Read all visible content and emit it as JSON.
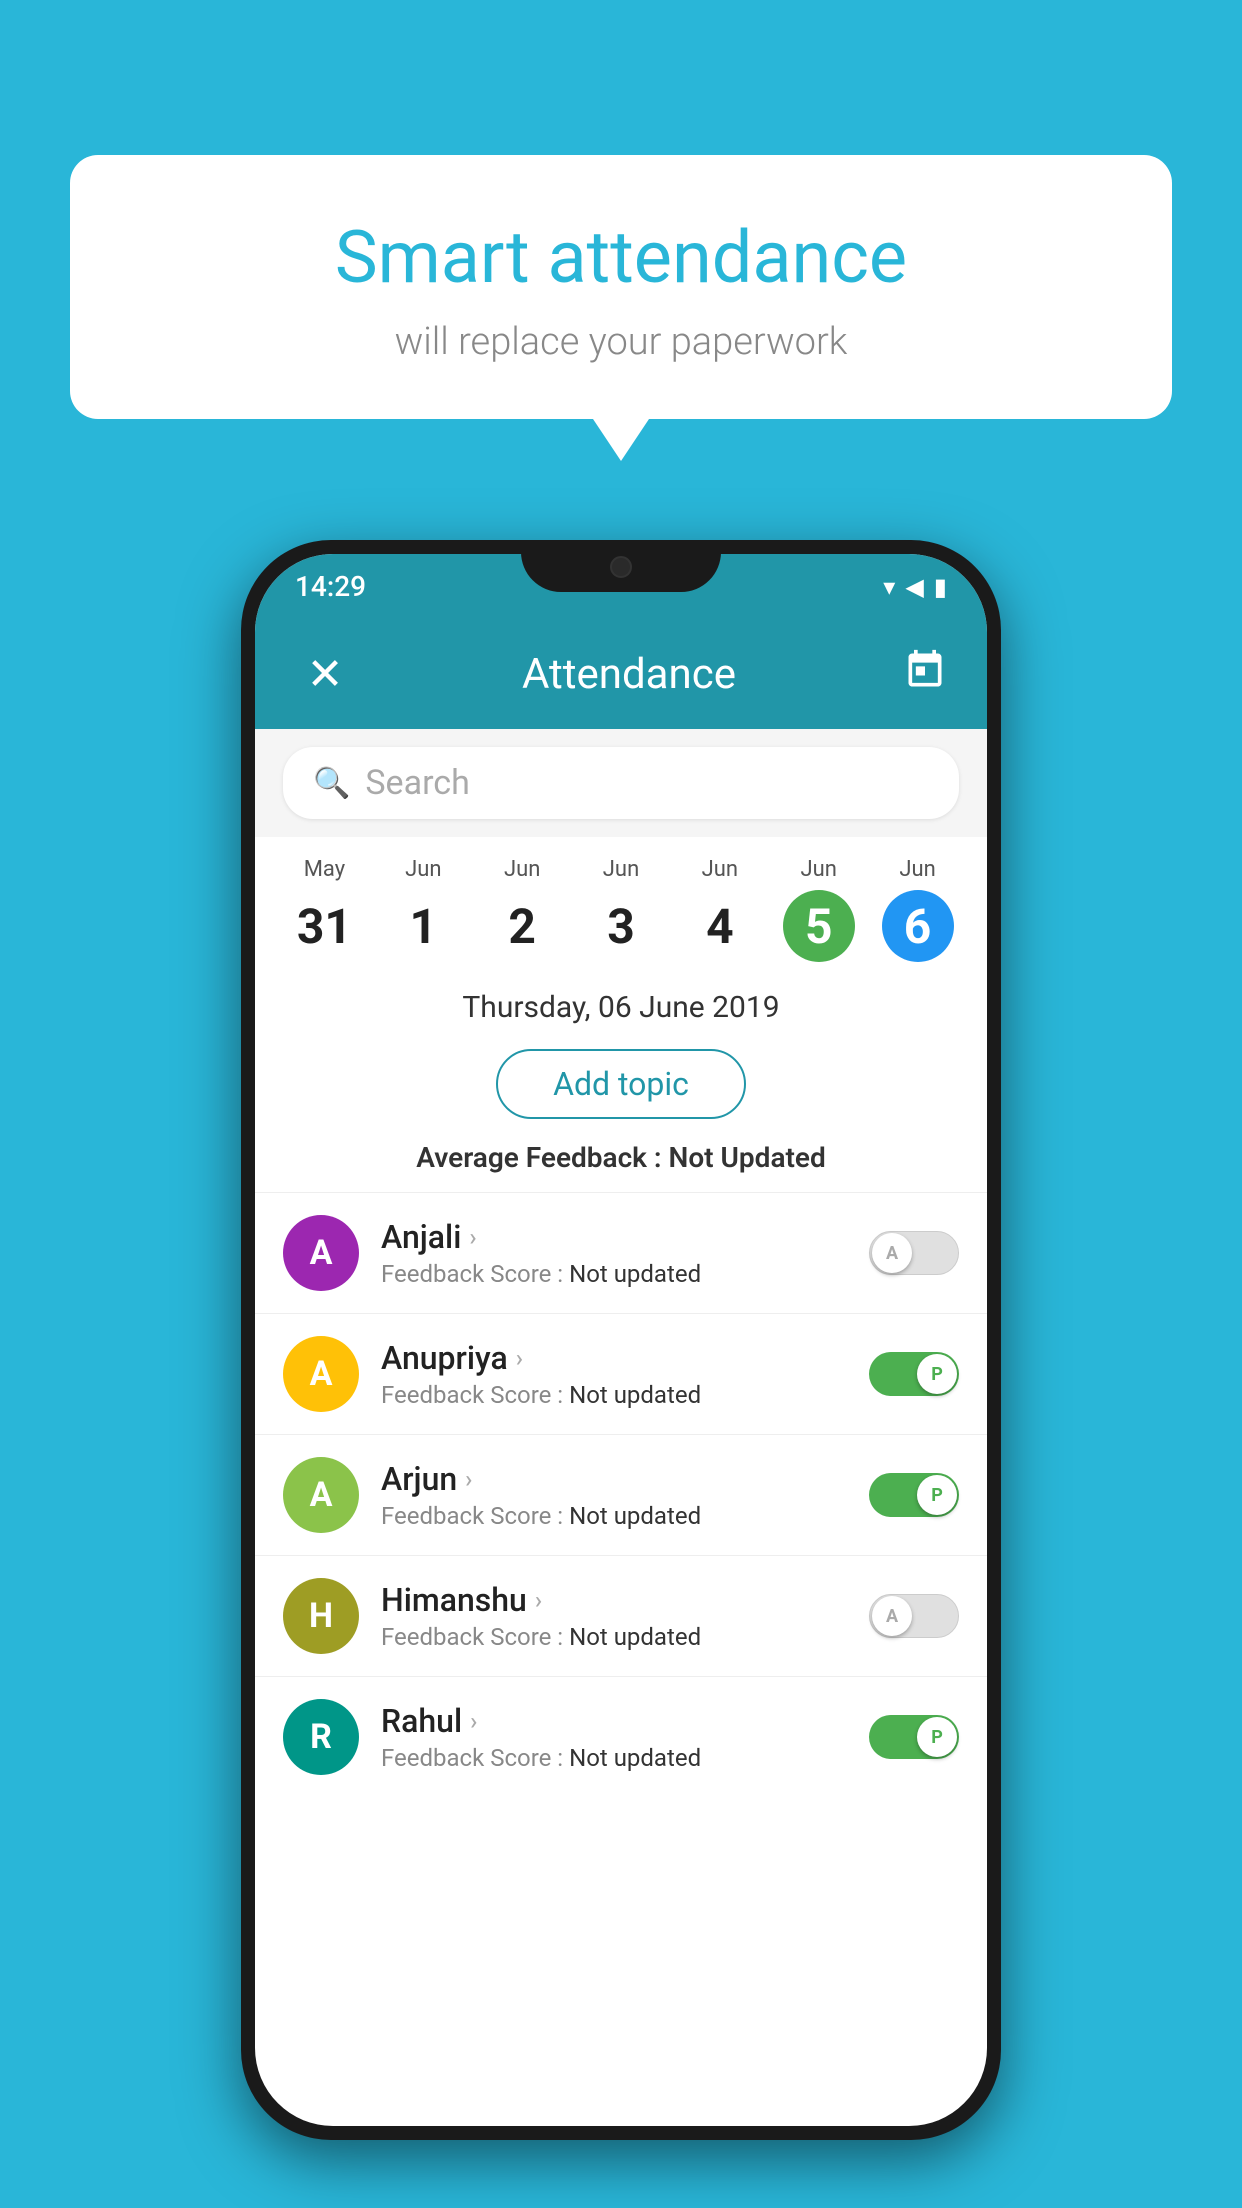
{
  "background_color": "#29B6D8",
  "speech_bubble": {
    "title": "Smart attendance",
    "subtitle": "will replace your paperwork"
  },
  "phone": {
    "status_bar": {
      "time": "14:29",
      "wifi": "▾",
      "signal": "▲",
      "battery": "▮"
    },
    "header": {
      "close_label": "×",
      "title": "Attendance",
      "calendar_label": "📅"
    },
    "search": {
      "placeholder": "Search"
    },
    "dates": [
      {
        "month": "May",
        "day": "31",
        "style": ""
      },
      {
        "month": "Jun",
        "day": "1",
        "style": ""
      },
      {
        "month": "Jun",
        "day": "2",
        "style": ""
      },
      {
        "month": "Jun",
        "day": "3",
        "style": ""
      },
      {
        "month": "Jun",
        "day": "4",
        "style": ""
      },
      {
        "month": "Jun",
        "day": "5",
        "style": "green"
      },
      {
        "month": "Jun",
        "day": "6",
        "style": "blue"
      }
    ],
    "selected_date": "Thursday, 06 June 2019",
    "add_topic_label": "Add topic",
    "avg_feedback_label": "Average Feedback : ",
    "avg_feedback_value": "Not Updated",
    "students": [
      {
        "name": "Anjali",
        "avatar_letter": "A",
        "avatar_color": "avatar-purple",
        "feedback_label": "Feedback Score : ",
        "feedback_value": "Not updated",
        "toggle": "off",
        "toggle_label": "A"
      },
      {
        "name": "Anupriya",
        "avatar_letter": "A",
        "avatar_color": "avatar-yellow",
        "feedback_label": "Feedback Score : ",
        "feedback_value": "Not updated",
        "toggle": "on",
        "toggle_label": "P"
      },
      {
        "name": "Arjun",
        "avatar_letter": "A",
        "avatar_color": "avatar-light-green",
        "feedback_label": "Feedback Score : ",
        "feedback_value": "Not updated",
        "toggle": "on",
        "toggle_label": "P"
      },
      {
        "name": "Himanshu",
        "avatar_letter": "H",
        "avatar_color": "avatar-olive",
        "feedback_label": "Feedback Score : ",
        "feedback_value": "Not updated",
        "toggle": "off",
        "toggle_label": "A"
      },
      {
        "name": "Rahul",
        "avatar_letter": "R",
        "avatar_color": "avatar-teal",
        "feedback_label": "Feedback Score : ",
        "feedback_value": "Not updated",
        "toggle": "on",
        "toggle_label": "P"
      }
    ]
  }
}
